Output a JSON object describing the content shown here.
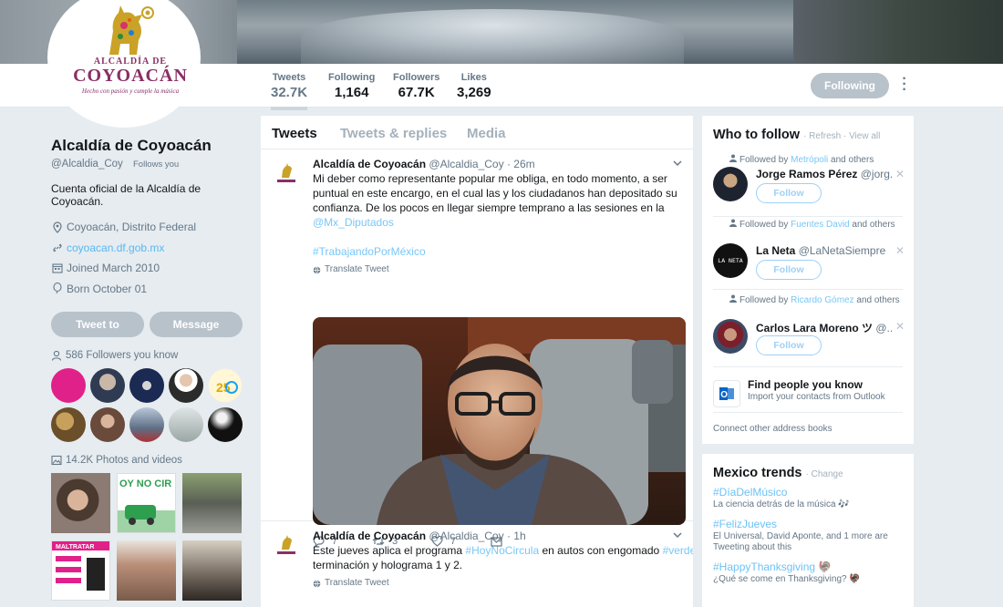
{
  "profile": {
    "name": "Alcaldía de Coyoacán",
    "handle": "@Alcaldia_Coy",
    "follows_you": "Follows you",
    "bio": "Cuenta oficial de la Alcaldía de Coyoacán.",
    "location": "Coyoacán, Distrito Federal",
    "website": "coyoacan.df.gob.mx",
    "joined": "Joined March 2010",
    "born": "Born October 01",
    "tweet_to_label": "Tweet to",
    "message_label": "Message",
    "followers_you_know": "586 Followers you know",
    "photos_videos": "14.2K Photos and videos",
    "logo": {
      "line1": "ALCALDÍA DE",
      "line2": "COYOACÁN",
      "line3": "Hecho con pasión y cumple la música"
    }
  },
  "nav": {
    "stats": [
      {
        "label": "Tweets",
        "value": "32.7K"
      },
      {
        "label": "Following",
        "value": "1,164"
      },
      {
        "label": "Followers",
        "value": "67.7K"
      },
      {
        "label": "Likes",
        "value": "3,269"
      }
    ],
    "following_label": "Following"
  },
  "timeline": {
    "tabs": [
      "Tweets",
      "Tweets & replies",
      "Media"
    ],
    "tweets": [
      {
        "name": "Alcaldía de Coyoacán",
        "handle": "@Alcaldia_Coy",
        "time": "· 26m",
        "lines": [
          "Mi deber como representante popular me obliga, en todo momento, a ser",
          "puntual en este encargo, en el cual las y los ciudadanos han depositado su",
          "confianza. De los pocos en llegar siempre temprano a las sesiones en la"
        ],
        "mention": "@Mx_Diputados",
        "hashtag": "#TrabajandoPorMéxico",
        "translate": "Translate Tweet",
        "replies": "7",
        "retweets": "3",
        "likes": "7"
      },
      {
        "name": "Alcaldía de Coyoacán",
        "handle": "@Alcaldia_Coy",
        "time": "· 1h",
        "text_a": "Este jueves aplica el programa ",
        "hashtag_a": "#HoyNoCircula",
        "text_b": " en autos con engomado ",
        "hashtag_b": "#verde",
        "text_c": ",",
        "line2": "terminación y holograma 1 y 2.",
        "translate": "Translate Tweet"
      }
    ]
  },
  "who_to_follow": {
    "title": "Who to follow",
    "refresh": "· Refresh · View all",
    "suggestions": [
      {
        "followed_by_prefix": "Followed by ",
        "followed_by": "Metrópoli",
        "followed_by_suffix": " and others",
        "name": "Jorge Ramos Pérez",
        "handle": "@jorg...",
        "follow_label": "Follow"
      },
      {
        "followed_by_prefix": "Followed by ",
        "followed_by": "Fuentes David",
        "followed_by_suffix": " and others",
        "name": "La Neta",
        "handle": "@LaNetaSiempre",
        "follow_label": "Follow",
        "avatar_text": "LA NETA"
      },
      {
        "followed_by_prefix": "Followed by ",
        "followed_by": "Ricardo Gómez",
        "followed_by_suffix": " and others",
        "name": "Carlos Lara Moreno ツ",
        "handle": "@...",
        "follow_label": "Follow"
      }
    ],
    "find_title": "Find people you know",
    "find_sub": "Import your contacts from Outlook",
    "connect": "Connect other address books"
  },
  "trends": {
    "title": "Mexico trends",
    "change": "· Change",
    "items": [
      {
        "tag": "#DíaDelMúsico",
        "desc": "La ciencia detrás de la música 🎶"
      },
      {
        "tag": "#FelizJueves",
        "desc": "El Universal, David Aponte, and 1 more are Tweeting about this"
      },
      {
        "tag": "#HappyThanksgiving 🦃",
        "desc": "¿Qué se come en Thanksgiving? 🦃"
      }
    ]
  },
  "colors": {
    "accent": "#1da1f2",
    "muted_button": "#b8c2cb",
    "brand": "#8a2f66"
  }
}
